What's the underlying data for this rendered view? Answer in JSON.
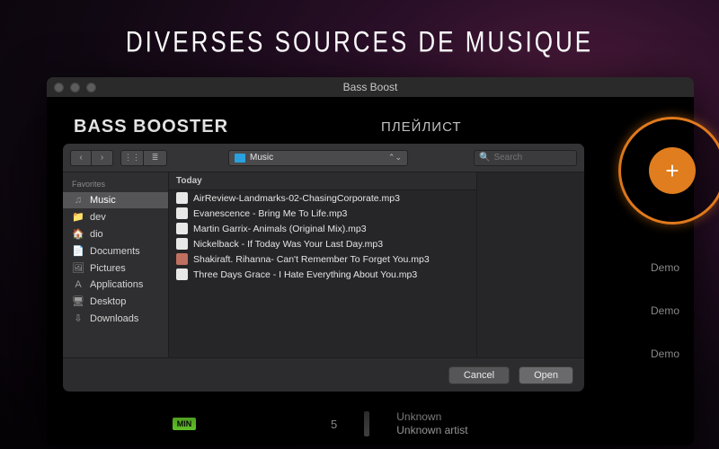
{
  "promo_title": "DIVERSES SOURCES DE MUSIQUE",
  "window": {
    "title": "Bass Boost",
    "brand": "BASS BOOSTER",
    "playlist_label": "ПЛЕЙЛИСТ"
  },
  "add_button": {
    "glyph": "+"
  },
  "demo_label": "Demo",
  "bottom": {
    "min": "MIN",
    "five": "5",
    "unknown_title": "Unknown",
    "unknown_artist": "Unknown artist"
  },
  "finder": {
    "location": "Music",
    "search_placeholder": "Search",
    "sidebar_header": "Favorites",
    "sidebar": [
      {
        "icon": "♫",
        "label": "Music",
        "selected": true
      },
      {
        "icon": "📁",
        "label": "dev"
      },
      {
        "icon": "🏠",
        "label": "dio"
      },
      {
        "icon": "📄",
        "label": "Documents"
      },
      {
        "icon": "🖼",
        "label": "Pictures"
      },
      {
        "icon": "A",
        "label": "Applications"
      },
      {
        "icon": "🖥",
        "label": "Desktop"
      },
      {
        "icon": "⇩",
        "label": "Downloads"
      }
    ],
    "group": "Today",
    "files": [
      {
        "type": "audio",
        "name": "AirReview-Landmarks-02-ChasingCorporate.mp3"
      },
      {
        "type": "audio",
        "name": "Evanescence - Bring Me To Life.mp3"
      },
      {
        "type": "audio",
        "name": "Martin Garrix- Animals (Original Mix).mp3"
      },
      {
        "type": "audio",
        "name": "Nickelback - If Today Was Your Last Day.mp3"
      },
      {
        "type": "img",
        "name": "Shakiraft. Rihanna- Can't Remember To Forget You.mp3"
      },
      {
        "type": "audio",
        "name": "Three Days Grace - I Hate Everything About You.mp3"
      }
    ],
    "cancel": "Cancel",
    "open": "Open"
  }
}
